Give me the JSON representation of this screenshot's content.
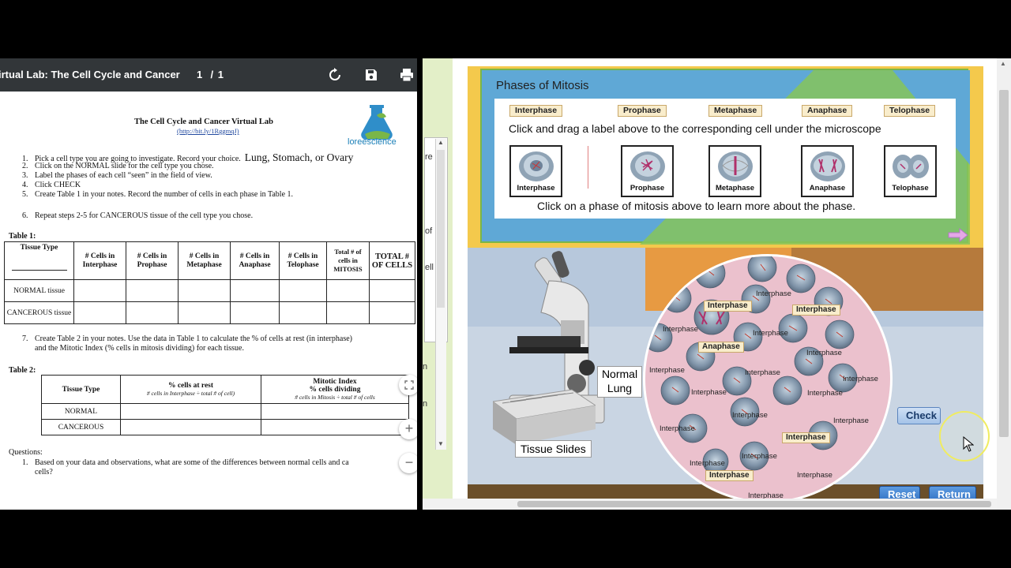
{
  "pdf": {
    "title": "irtual Lab: The Cell Cycle and Cancer",
    "page_current": "1",
    "page_sep": "/",
    "page_total": "1",
    "doc_title": "The Cell Cycle and Cancer Virtual Lab",
    "doc_link": "(http://bit.ly/1RggmqJ)",
    "logo_text": "loreescience",
    "steps": [
      {
        "n": "1.",
        "text": "Pick a cell type you are going to investigate. Record your choice.",
        "extra": "Lung, Stomach, or Ovary"
      },
      {
        "n": "2.",
        "text": "Click on the NORMAL slide for the cell type you chose."
      },
      {
        "n": "3.",
        "text": "Label the phases of each cell “seen” in the field of view."
      },
      {
        "n": "4.",
        "text": "Click CHECK"
      },
      {
        "n": "5.",
        "text": "Create Table 1 in your notes.  Record the number of cells in each phase in Table 1."
      },
      {
        "n": "6.",
        "text": "Repeat steps 2-5 for CANCEROUS tissue of the cell type you chose."
      }
    ],
    "table1": {
      "label": "Table 1:",
      "headers": [
        "Tissue Type",
        "# Cells in Interphase",
        "# Cells in Prophase",
        "# Cells in Metaphase",
        "# Cells in Anaphase",
        "# Cells in Telophase",
        "Total # of cells in MITOSIS",
        "TOTAL # OF CELLS"
      ],
      "rows": [
        [
          "NORMAL tissue"
        ],
        [
          "CANCEROUS tissue"
        ]
      ]
    },
    "step7": {
      "n": "7.",
      "line1": "Create Table 2 in your notes.  Use the data in Table 1 to calculate the % of cells at rest (in interphase)",
      "line2": "and the Mitotic Index (% cells in mitosis dividing) for each tissue."
    },
    "table2": {
      "label": "Table 2:",
      "h_type": "Tissue Type",
      "h_rest": "% cells at rest",
      "h_rest_sub": "# cells in Interphase ÷ total # of cell)",
      "h_mi": "Mitotic Index",
      "h_mi2": "% cells dividing",
      "h_mi_sub": "# cells in Mitosis ÷ total # of cells",
      "rows": [
        "NORMAL",
        "CANCEROUS"
      ]
    },
    "questions_label": "Questions:",
    "q1": {
      "n": "1.",
      "line1": "Based on your data and observations, what are some of the differences between normal cells and ca",
      "line2": "cells?"
    },
    "zoom_plus": "+",
    "zoom_minus": "−"
  },
  "left_ghost_text": [
    "re",
    "of",
    "ell",
    "n",
    "n"
  ],
  "lab": {
    "panel_title": "Phases of Mitosis",
    "labels": [
      "Interphase",
      "Prophase",
      "Metaphase",
      "Anaphase",
      "Telophase"
    ],
    "instruction_drag": "Click and drag a label above to the corresponding cell under the microscope",
    "instruction_click": "Click on a phase of mitosis above to learn more about the phase.",
    "cards": [
      "Interphase",
      "Prophase",
      "Metaphase",
      "Anaphase",
      "Telophase"
    ],
    "normal_lung": "Normal Lung",
    "tissue_slides": "Tissue Slides",
    "tags": [
      "Interphase",
      "Interphase",
      "Anaphase",
      "Interphase",
      "Interphase"
    ],
    "cell_labels": [
      "Interphase",
      "Interphase",
      "Interphase",
      "Interphase",
      "Interphase",
      "Interphase",
      "Interphase",
      "Interphase",
      "Interphase",
      "Interphase",
      "Interphase",
      "Interphase",
      "Interphase",
      "Interphase",
      "Interphase",
      "Interphase",
      "Interphase",
      "Interphase"
    ],
    "check": "Check",
    "reset": "Reset",
    "return": "Return"
  },
  "colors": {
    "accent": "#2f6fc2",
    "panel_blue": "#5fa8d6",
    "tag_bg": "#f9edcc"
  }
}
